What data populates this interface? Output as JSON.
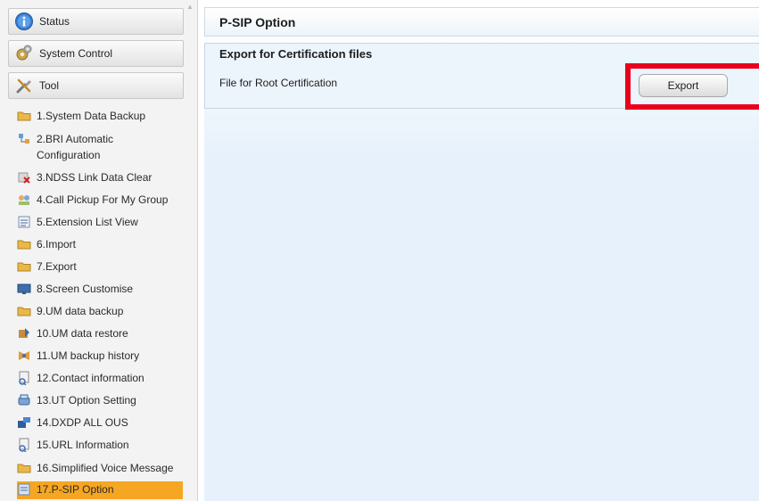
{
  "sidebar": {
    "tabs": [
      {
        "label": "Status",
        "icon": "status-icon"
      },
      {
        "label": "System Control",
        "icon": "system-control-icon"
      },
      {
        "label": "Tool",
        "icon": "tool-icon"
      }
    ],
    "items": [
      {
        "label": "1.System Data Backup",
        "icon": "folder-icon"
      },
      {
        "label": "2.BRI Automatic\nConfiguration",
        "icon": "network-config-icon"
      },
      {
        "label": "3.NDSS Link Data Clear",
        "icon": "clear-link-icon"
      },
      {
        "label": "4.Call Pickup For My Group",
        "icon": "group-pickup-icon"
      },
      {
        "label": "5.Extension List View",
        "icon": "list-view-icon"
      },
      {
        "label": "6.Import",
        "icon": "folder-icon"
      },
      {
        "label": "7.Export",
        "icon": "folder-icon"
      },
      {
        "label": "8.Screen Customise",
        "icon": "monitor-icon"
      },
      {
        "label": "9.UM data backup",
        "icon": "folder-icon"
      },
      {
        "label": "10.UM data restore",
        "icon": "restore-icon"
      },
      {
        "label": "11.UM backup history",
        "icon": "history-icon"
      },
      {
        "label": "12.Contact information",
        "icon": "contact-info-icon"
      },
      {
        "label": "13.UT Option Setting",
        "icon": "phone-option-icon"
      },
      {
        "label": "14.DXDP ALL OUS",
        "icon": "dxdp-icon"
      },
      {
        "label": "15.URL Information",
        "icon": "url-info-icon"
      },
      {
        "label": "16.Simplified Voice Message",
        "icon": "folder-icon"
      },
      {
        "label": "17.P-SIP Option",
        "icon": "psip-option-icon",
        "active": true
      }
    ]
  },
  "main": {
    "title": "P-SIP Option",
    "panel": {
      "title": "Export for Certification files",
      "field_label": "File for Root Certification",
      "button_label": "Export"
    }
  },
  "colors": {
    "active_item": "#f5a623",
    "highlight": "#e8001c",
    "content_bg": "#e7f1fb"
  }
}
